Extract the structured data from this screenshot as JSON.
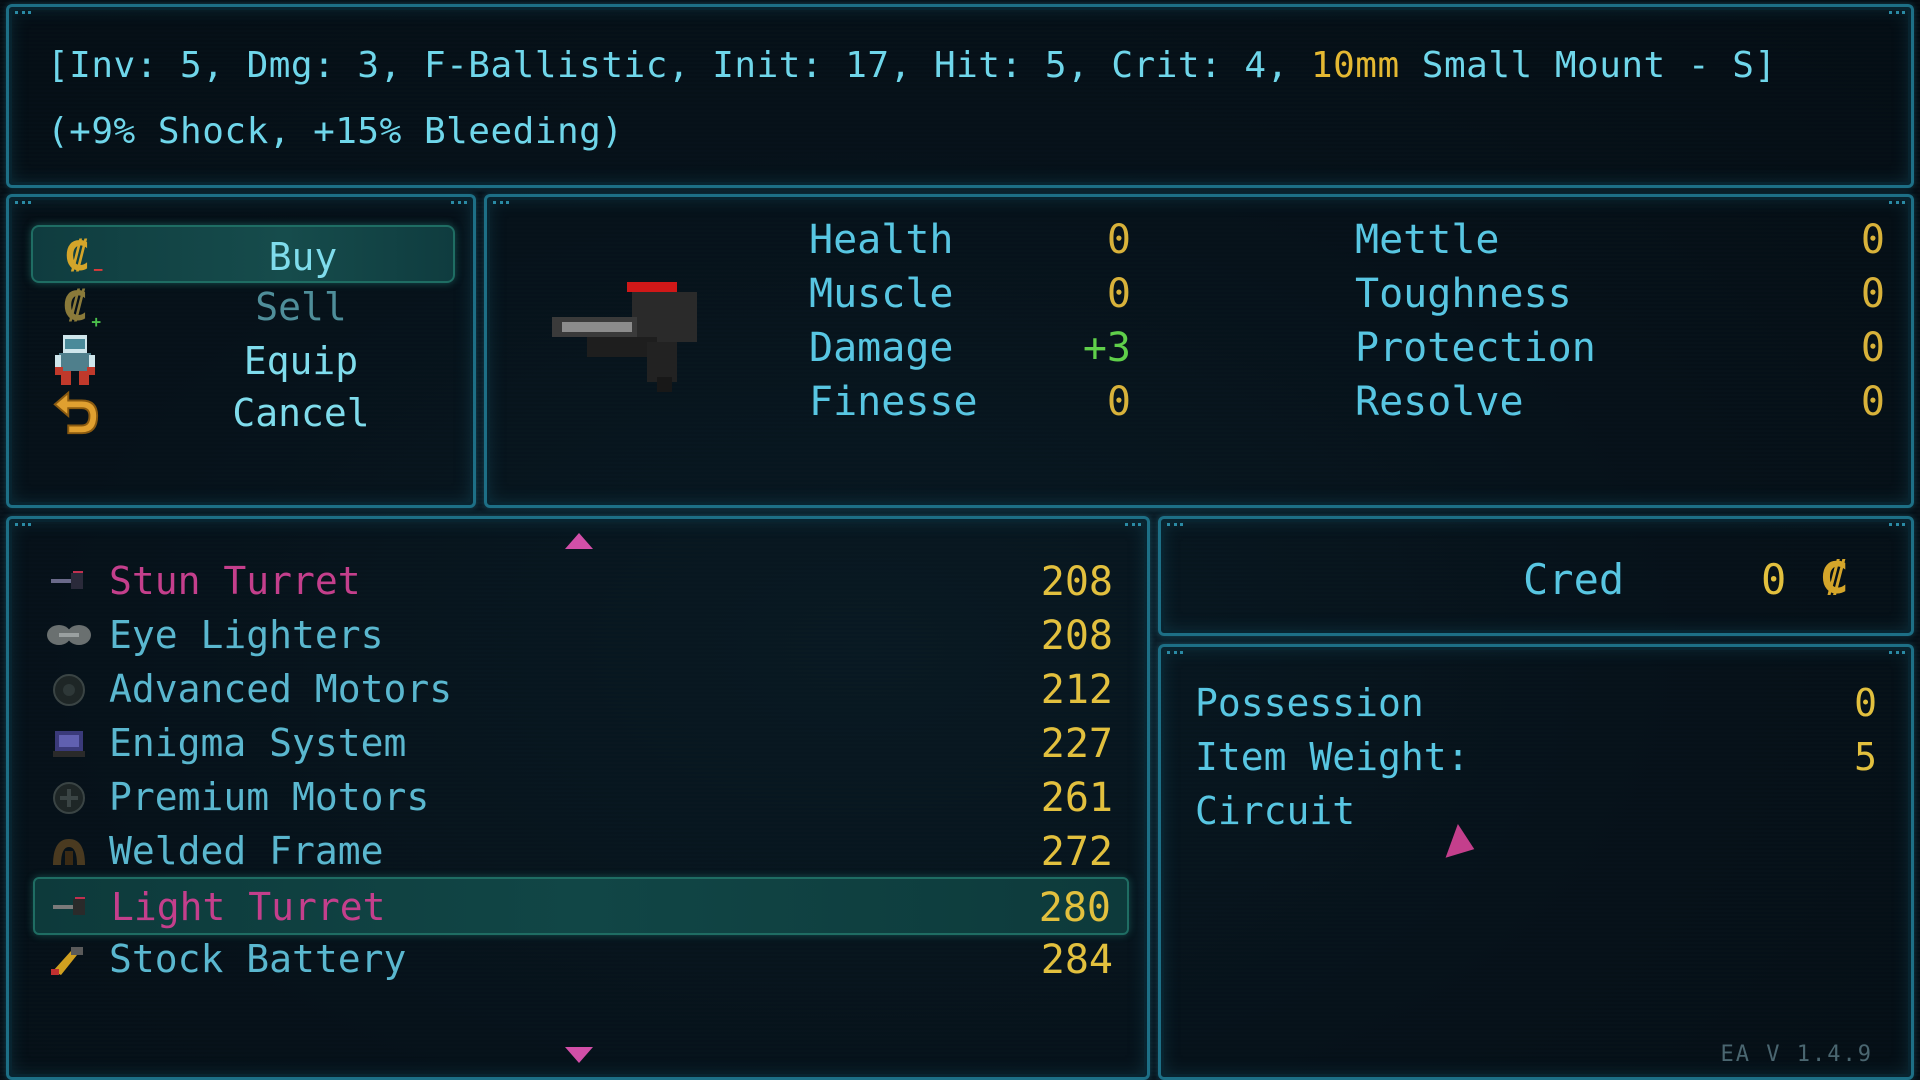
{
  "description": {
    "line1_prefix": "[Inv: 5, Dmg: 3, F-Ballistic, Init: 17, Hit: 5, Crit: 4, ",
    "line1_mount": "10mm",
    "line1_suffix": " Small Mount - S]",
    "line2": "(+9% Shock, +15% Bleeding)"
  },
  "actions": [
    {
      "label": "Buy",
      "icon": "cred-minus-icon",
      "selected": true
    },
    {
      "label": "Sell",
      "icon": "cred-plus-icon",
      "selected": false
    },
    {
      "label": "Equip",
      "icon": "character-icon",
      "selected": false
    },
    {
      "label": "Cancel",
      "icon": "return-arrow-icon",
      "selected": false
    }
  ],
  "stats": {
    "left": [
      {
        "name": "Health",
        "value": "0"
      },
      {
        "name": "Muscle",
        "value": "0"
      },
      {
        "name": "Damage",
        "value": "+3"
      },
      {
        "name": "Finesse",
        "value": "0"
      }
    ],
    "right": [
      {
        "name": "Mettle",
        "value": "0"
      },
      {
        "name": "Toughness",
        "value": "0"
      },
      {
        "name": "Protection",
        "value": "0"
      },
      {
        "name": "Resolve",
        "value": "0"
      }
    ]
  },
  "items": [
    {
      "name": "Stun Turret",
      "price": "208",
      "icon": "turret-icon",
      "highlight": true
    },
    {
      "name": "Eye Lighters",
      "price": "208",
      "icon": "goggles-icon",
      "highlight": false
    },
    {
      "name": "Advanced Motors",
      "price": "212",
      "icon": "motor-icon",
      "highlight": false
    },
    {
      "name": "Enigma System",
      "price": "227",
      "icon": "computer-icon",
      "highlight": false
    },
    {
      "name": "Premium Motors",
      "price": "261",
      "icon": "motor-icon",
      "highlight": false
    },
    {
      "name": "Welded Frame",
      "price": "272",
      "icon": "frame-icon",
      "highlight": false
    },
    {
      "name": "Light Turret",
      "price": "280",
      "icon": "turret-icon",
      "highlight": true
    },
    {
      "name": "Stock Battery",
      "price": "284",
      "icon": "battery-icon",
      "highlight": false
    }
  ],
  "cred": {
    "label": "Cred",
    "value": "0"
  },
  "info": {
    "possession_label": "Possession",
    "possession_value": "0",
    "weight_label": "Item Weight:",
    "weight_value": "5",
    "circuit_label": "Circuit"
  },
  "version": "EA V 1.4.9",
  "colors": {
    "accent": "#1d6f86",
    "gold": "#e2c03e",
    "magenta": "#c43f8c",
    "positive": "#5fcf4a"
  }
}
